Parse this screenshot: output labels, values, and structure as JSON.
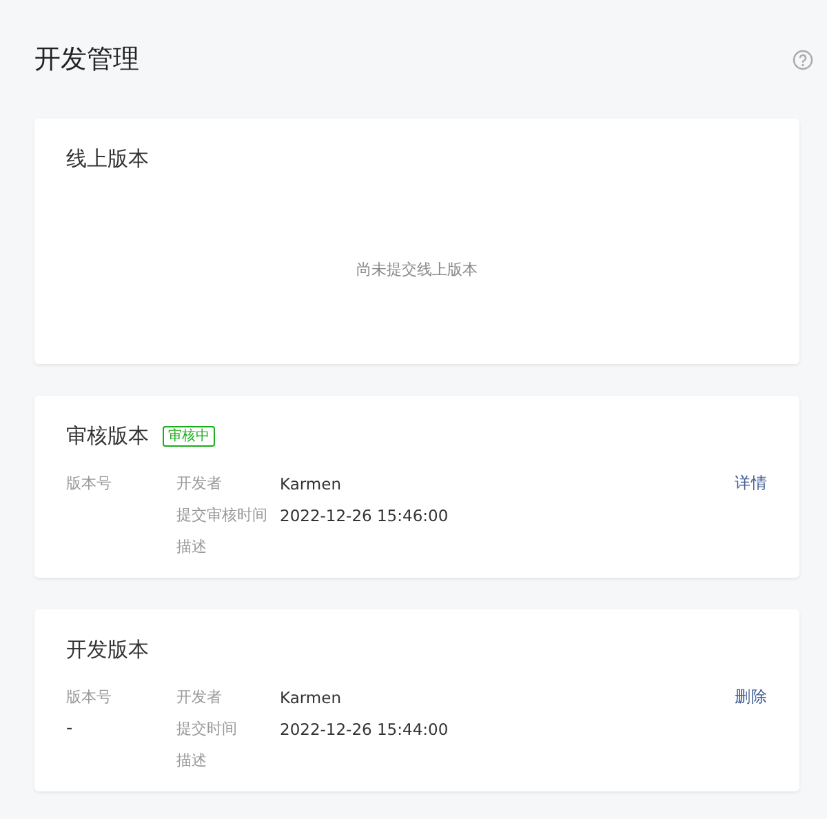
{
  "page": {
    "title": "开发管理"
  },
  "sections": [
    {
      "title": "线上版本",
      "empty_text": "尚未提交线上版本"
    },
    {
      "title": "审核版本",
      "badge": "审核中",
      "version_label": "版本号",
      "fields": [
        {
          "label": "开发者",
          "value": "Karmen"
        },
        {
          "label": "提交审核时间",
          "value": "2022-12-26 15:46:00"
        },
        {
          "label": "描述"
        }
      ],
      "action": "详情"
    },
    {
      "title": "开发版本",
      "version_label": "版本号",
      "version": "-",
      "fields": [
        {
          "label": "开发者",
          "value": "Karmen"
        },
        {
          "label": "提交时间",
          "value": "2022-12-26 15:44:00"
        },
        {
          "label": "描述"
        }
      ],
      "action": "删除"
    }
  ]
}
